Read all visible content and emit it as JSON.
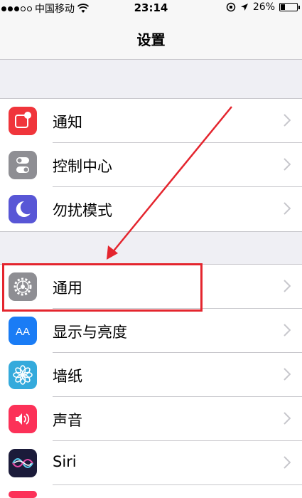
{
  "status_bar": {
    "carrier": "中国移动",
    "time": "23:14",
    "battery_text": "26%",
    "battery_level": 0.26
  },
  "nav": {
    "title": "设置"
  },
  "groups": [
    [
      {
        "label": "通知",
        "icon": "notifications-icon",
        "color": "#f0353b"
      },
      {
        "label": "控制中心",
        "icon": "control-center-icon",
        "color": "#8e8e93"
      },
      {
        "label": "勿扰模式",
        "icon": "moon-icon",
        "color": "#5856d6"
      }
    ],
    [
      {
        "label": "通用",
        "icon": "gear-icon",
        "color": "#8e8e93"
      },
      {
        "label": "显示与亮度",
        "icon": "display-brightness-icon",
        "color": "#1a7cf5",
        "icon_text": "AA"
      },
      {
        "label": "墙纸",
        "icon": "wallpaper-icon",
        "color": "#34aadc"
      },
      {
        "label": "声音",
        "icon": "speaker-icon",
        "color": "#fc3158"
      },
      {
        "label": "Siri",
        "icon": "siri-icon",
        "color": "#1b1b3a"
      }
    ]
  ],
  "annotation": {
    "highlight_color": "#e4252e"
  }
}
